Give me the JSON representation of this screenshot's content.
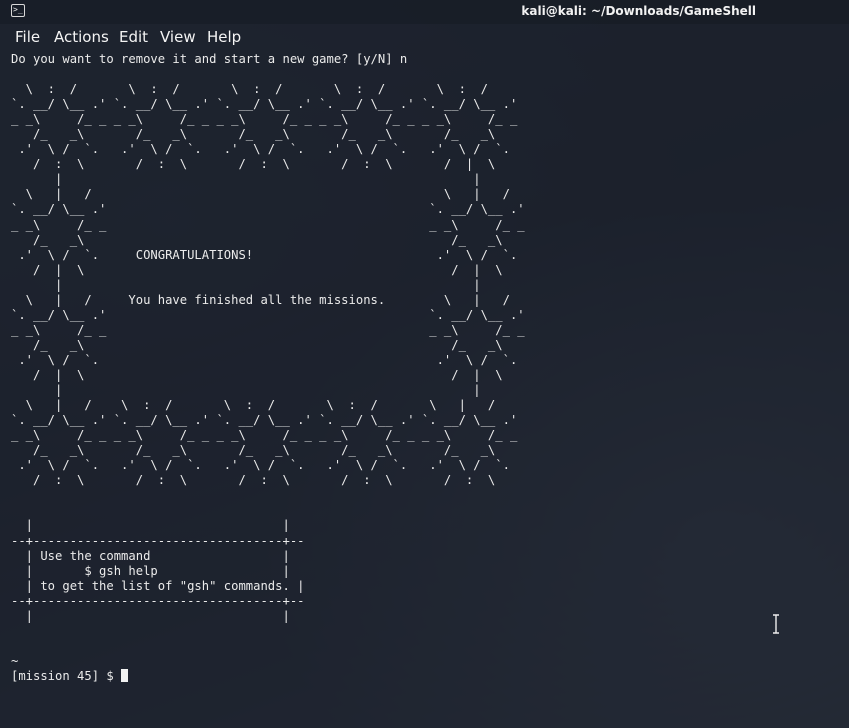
{
  "window": {
    "title": "kali@kali: ~/Downloads/GameShell"
  },
  "menu": [
    "File",
    "Actions",
    "Edit",
    "View",
    "Help"
  ],
  "terminal": {
    "lines": [
      "Do you want to remove it and start a new game? [y/N] n",
      "",
      "  \\  :  /       \\  :  /       \\  :  /       \\  :  /       \\  :  /",
      "`. __/ \\__ .' `. __/ \\__ .' `. __/ \\__ .' `. __/ \\__ .' `. __/ \\__ .'",
      "_ _\\     /_ _ _ _\\     /_ _ _ _\\     /_ _ _ _\\     /_ _ _ _\\     /_ _",
      "   /_   _\\       /_   _\\       /_   _\\       /_   _\\       /_   _\\",
      " .'  \\ /  `.   .'  \\ /  `.   .'  \\ /  `.   .'  \\ /  `.   .'  \\ /  `.",
      "   /  :  \\       /  :  \\       /  :  \\       /  :  \\       /  |  \\",
      "      |                                                        |",
      "  \\   |   /                                                \\   |   /",
      "`. __/ \\__ .'                                            `. __/ \\__ .'",
      "_ _\\     /_ _                                            _ _\\     /_ _",
      "   /_   _\\                                                  /_   _\\",
      " .'  \\ /  `.     CONGRATULATIONS!                         .'  \\ /  `.",
      "   /  |  \\                                                  /  |  \\",
      "      |                                                        |",
      "  \\   |   /     You have finished all the missions.        \\   |   /",
      "`. __/ \\__ .'                                            `. __/ \\__ .'",
      "_ _\\     /_ _                                            _ _\\     /_ _",
      "   /_   _\\                                                  /_   _\\",
      " .'  \\ /  `.                                              .'  \\ /  `.",
      "   /  |  \\                                                  /  |  \\",
      "      |                                                        |",
      "  \\   |   /    \\  :  /       \\  :  /       \\  :  /       \\   |   /",
      "`. __/ \\__ .' `. __/ \\__ .' `. __/ \\__ .' `. __/ \\__ .' `. __/ \\__ .'",
      "_ _\\     /_ _ _ _\\     /_ _ _ _\\     /_ _ _ _\\     /_ _ _ _\\     /_ _",
      "   /_   _\\       /_   _\\       /_   _\\       /_   _\\       /_   _\\",
      " .'  \\ /  `.   .'  \\ /  `.   .'  \\ /  `.   .'  \\ /  `.   .'  \\ /  `.",
      "   /  :  \\       /  :  \\       /  :  \\       /  :  \\       /  :  \\",
      "",
      "",
      "  |                                  |",
      "--+----------------------------------+--",
      "  | Use the command                  |",
      "  |       $ gsh help                 |",
      "  | to get the list of \"gsh\" commands. |",
      "--+----------------------------------+--",
      "  |                                  |",
      "",
      "",
      "~"
    ],
    "prompt": "[mission 45] $ "
  }
}
